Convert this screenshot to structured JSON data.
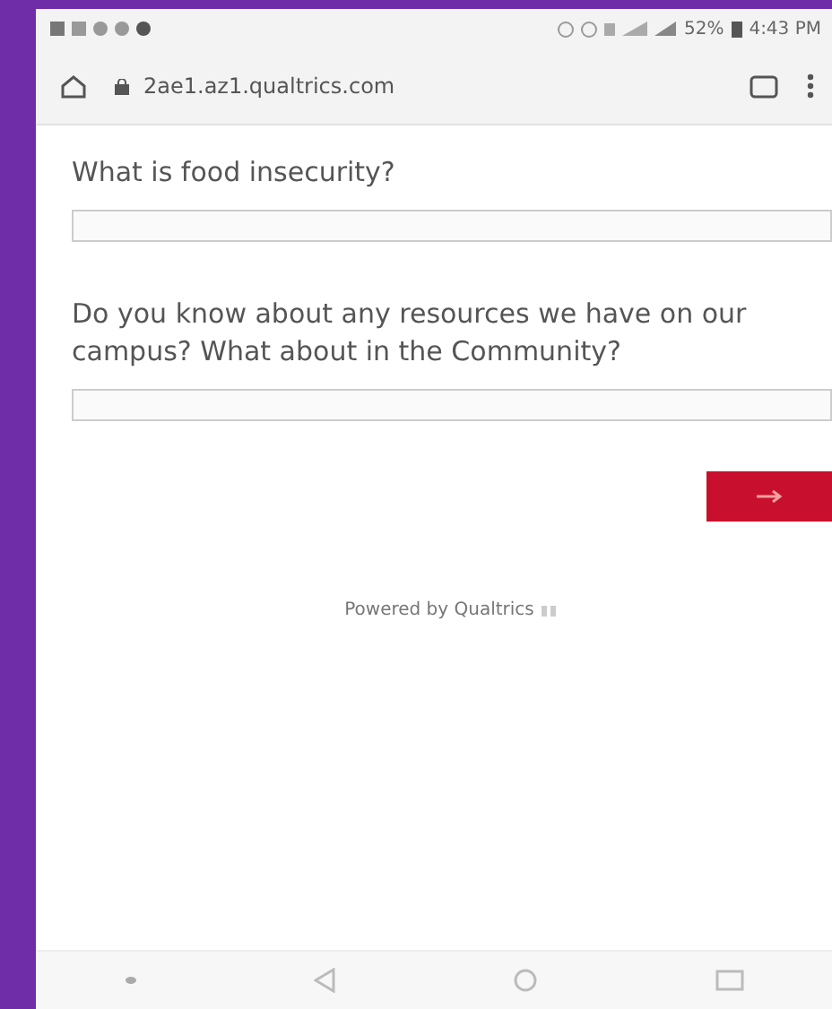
{
  "status_bar": {
    "battery": "52%",
    "time": "4:43 PM"
  },
  "address_bar": {
    "url": "2ae1.az1.qualtrics.com"
  },
  "questions": [
    {
      "text": "What is food insecurity?"
    },
    {
      "text": "Do you know about any resources we have on our campus? What about in the Community?"
    }
  ],
  "footer": {
    "text": "Powered by Qualtrics"
  }
}
